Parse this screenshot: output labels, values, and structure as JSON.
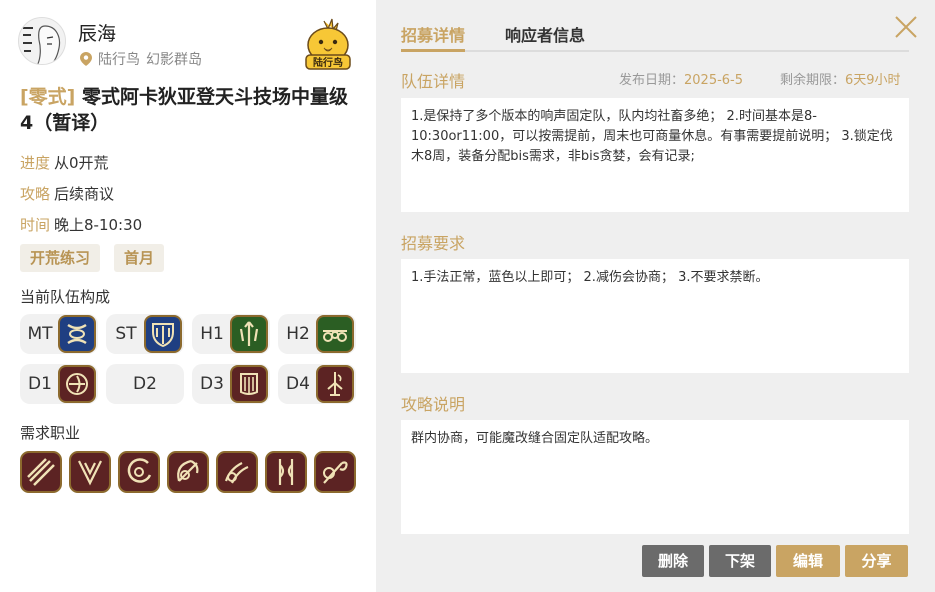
{
  "user": {
    "name": "辰海",
    "server": "陆行鸟",
    "world": "幻影群岛"
  },
  "mascot": {
    "label": "陆行鸟"
  },
  "party": {
    "tag": "[零式]",
    "title": "零式阿卡狄亚登天斗技场中量级4（暂译）",
    "progress_label": "进度",
    "progress_value": "从0开荒",
    "strategy_label": "攻略",
    "strategy_value": "后续商议",
    "time_label": "时间",
    "time_value": "晚上8-10:30",
    "chips": [
      "开荒练习",
      "首月"
    ],
    "composition_label": "当前队伍构成",
    "slots": [
      {
        "label": "MT",
        "icon": "paladin-job-icon"
      },
      {
        "label": "ST",
        "icon": "warrior-job-icon"
      },
      {
        "label": "H1",
        "icon": "white-mage-job-icon"
      },
      {
        "label": "H2",
        "icon": "astrologian-job-icon"
      },
      {
        "label": "D1",
        "icon": "monk-job-icon"
      },
      {
        "label": "D2",
        "icon": ""
      },
      {
        "label": "D3",
        "icon": "bard-job-icon"
      },
      {
        "label": "D4",
        "icon": "black-mage-job-icon"
      }
    ],
    "needed_label": "需求职业",
    "needed_jobs": [
      "dragoon-job-icon",
      "ninja-job-icon",
      "samurai-job-icon",
      "reaper-job-icon",
      "black-mage-job-icon",
      "viper-job-icon",
      "pictomancer-job-icon"
    ]
  },
  "tabs": {
    "recruit": "招募详情",
    "responders": "响应者信息"
  },
  "details": {
    "team_title": "队伍详情",
    "date_label": "发布日期：",
    "date_value": "2025-6-5",
    "remain_label": "剩余期限：",
    "remain_value": "6天9小时",
    "team_text": "1.是保持了多个版本的响声固定队，队内均社畜多绝； 2.时间基本是8-10:30or11:00，可以按需提前，周末也可商量休息。有事需要提前说明； 3.锁定伐木8周，装备分配bis需求，非bis贪婪，会有记录;",
    "req_title": "招募要求",
    "req_text": "1.手法正常，蓝色以上即可； 2.减伤会协商； 3.不要求禁断。",
    "strat_title": "攻略说明",
    "strat_text": "群内协商，可能魔改缝合固定队适配攻略。"
  },
  "buttons": {
    "delete": "删除",
    "unlist": "下架",
    "edit": "编辑",
    "share": "分享"
  },
  "colors": {
    "accent": "#c9a463",
    "dark_button": "#6b6b6b"
  }
}
